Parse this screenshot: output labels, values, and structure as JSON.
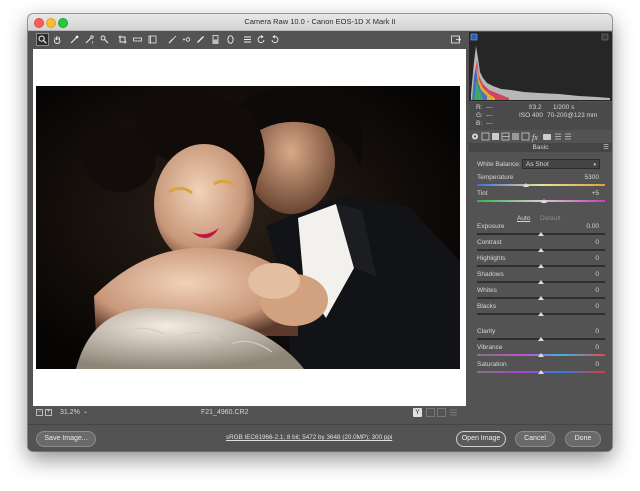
{
  "window": {
    "title": "Camera Raw 10.0  -  Canon EOS-1D X Mark II"
  },
  "toolbar": {
    "tools": [
      "zoom-icon",
      "hand-icon",
      "white-balance-icon",
      "color-sampler-icon",
      "target-adjust-icon",
      "crop-icon",
      "straighten-icon",
      "transform-icon",
      "spot-removal-icon",
      "red-eye-icon",
      "adjustment-brush-icon",
      "graduated-filter-icon",
      "radial-filter-icon",
      "preferences-icon",
      "rotate-left-icon",
      "rotate-right-icon"
    ],
    "fullscreen_icon": "fullscreen-icon"
  },
  "statusbar": {
    "zoom": "31.2%",
    "filename": "F21_4960.CR2"
  },
  "camera_info": {
    "r_label": "R:",
    "r_value": "---",
    "g_label": "G:",
    "g_value": "---",
    "b_label": "B:",
    "b_value": "---",
    "aperture": "f/3.2",
    "shutter": "1/200 s",
    "iso": "ISO 400",
    "lens": "70-200@123 mm"
  },
  "basic_panel": {
    "title": "Basic",
    "white_balance_label": "White Balance:",
    "white_balance_value": "As Shot",
    "auto_label": "Auto",
    "default_label": "Default",
    "sliders": [
      {
        "label": "Temperature",
        "value": "5300",
        "position": 0.38
      },
      {
        "label": "Tint",
        "value": "+5",
        "position": 0.52
      },
      {
        "label": "Exposure",
        "value": "0.00",
        "position": 0.5
      },
      {
        "label": "Contrast",
        "value": "0",
        "position": 0.5
      },
      {
        "label": "Highlights",
        "value": "0",
        "position": 0.5
      },
      {
        "label": "Shadows",
        "value": "0",
        "position": 0.5
      },
      {
        "label": "Whites",
        "value": "0",
        "position": 0.5
      },
      {
        "label": "Blacks",
        "value": "0",
        "position": 0.5
      },
      {
        "label": "Clarity",
        "value": "0",
        "position": 0.5
      },
      {
        "label": "Vibrance",
        "value": "0",
        "position": 0.5
      },
      {
        "label": "Saturation",
        "value": "0",
        "position": 0.5
      }
    ]
  },
  "bottom": {
    "save_label": "Save Image...",
    "workflow_label": "sRGB IEC61966-2.1; 8 bit; 5472 by 3648 (20.0MP); 300 ppi",
    "open_label": "Open Image",
    "cancel_label": "Cancel",
    "done_label": "Done"
  },
  "colors": {
    "accent": "#3d7de0",
    "panel": "#535353",
    "histogram_bg": "#262626"
  }
}
